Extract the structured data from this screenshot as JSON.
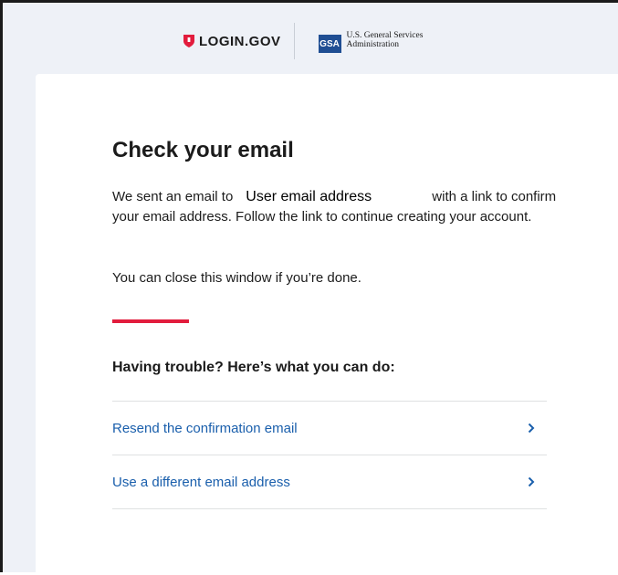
{
  "header": {
    "login_logo_text": "LOGIN.GOV",
    "gsa_logo_text": "GSA",
    "gsa_name_line1": "U.S. General Services",
    "gsa_name_line2": "Administration"
  },
  "main": {
    "title": "Check your email",
    "paragraph1_before": "We sent an email to",
    "email_placeholder": "User email address",
    "paragraph1_after": "with a link to confirm your email address. Follow the link to continue creating your account.",
    "paragraph2": "You can close this window if you’re done.",
    "help_heading": "Having trouble? Here’s what you can do:",
    "options": [
      {
        "label": "Resend the confirmation email"
      },
      {
        "label": "Use a different email address"
      }
    ]
  },
  "colors": {
    "accent_red": "#e21c3d",
    "link_blue": "#1a5fac",
    "gsa_blue": "#1f4e93",
    "background": "#eef1f7"
  }
}
